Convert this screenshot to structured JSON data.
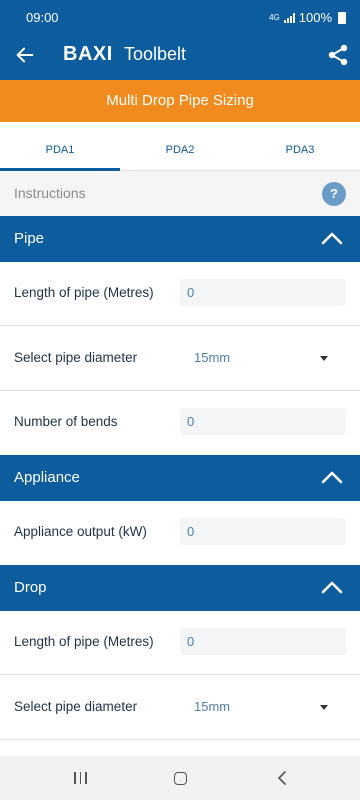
{
  "status_bar": {
    "time": "09:00",
    "network": "4G",
    "battery": "100%"
  },
  "app_bar": {
    "brand": "BAXI",
    "subtitle": "Toolbelt"
  },
  "banner": {
    "title": "Multi Drop Pipe Sizing"
  },
  "tabs": [
    {
      "label": "PDA1"
    },
    {
      "label": "PDA2"
    },
    {
      "label": "PDA3"
    }
  ],
  "instructions": {
    "label": "Instructions",
    "help": "?"
  },
  "sections": {
    "pipe": {
      "title": "Pipe",
      "length_label": "Length of pipe (Metres)",
      "length_value": "0",
      "diameter_label": "Select pipe diameter",
      "diameter_value": "15mm",
      "bends_label": "Number of bends",
      "bends_value": "0"
    },
    "appliance": {
      "title": "Appliance",
      "output_label": "Appliance output (kW)",
      "output_value": "0"
    },
    "drop": {
      "title": "Drop",
      "length_label": "Length of pipe (Metres)",
      "length_value": "0",
      "diameter_label": "Select pipe diameter",
      "diameter_value": "15mm"
    }
  },
  "colors": {
    "primary": "#0d5c9e",
    "accent": "#f28b1e",
    "field_text": "#4f7fab"
  },
  "icons": [
    "back-arrow-icon",
    "share-icon",
    "help-icon",
    "chevron-up-icon",
    "dropdown-caret-icon",
    "recents-icon",
    "home-icon",
    "back-nav-icon"
  ]
}
